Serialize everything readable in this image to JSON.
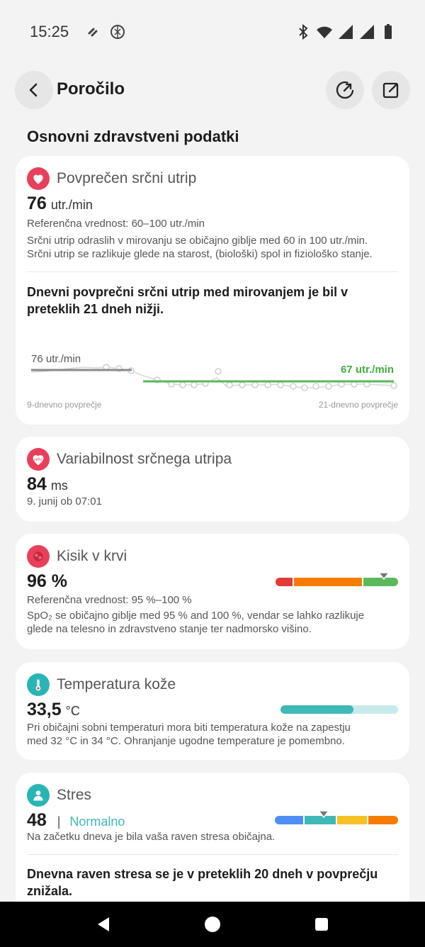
{
  "status": {
    "time": "15:25"
  },
  "header": {
    "title": "Poročilo"
  },
  "section": {
    "title": "Osnovni zdravstveni podatki"
  },
  "heart": {
    "title": "Povprečen srčni utrip",
    "value": "76",
    "unit": "utr./min",
    "reference": "Referenčna vrednost: 60–100 utr./min",
    "desc1": "Srčni utrip odraslih v mirovanju se običajno giblje med 60 in 100 utr./min.",
    "desc2": "Srčni utrip se razlikuje glede na starost, (biološki) spol in fiziološko stanje.",
    "insight": "Dnevni povprečni srčni utrip med mirovanjem je bil v preteklih 21 dneh nižji.",
    "chart_data": {
      "type": "line",
      "series": [
        {
          "name": "9-dnevno povprečje",
          "values": [
            76
          ]
        },
        {
          "name": "21-dnevno povprečje",
          "values": [
            67
          ]
        }
      ],
      "left_label": "76 utr./min",
      "right_label": "67 utr./min",
      "x_left": "9-dnevno povprečje",
      "x_right": "21-dnevno povprečje"
    }
  },
  "hrv": {
    "title": "Variabilnost srčnega utripa",
    "icon_text": "HRV",
    "value": "84",
    "unit": "ms",
    "date": "9. junij ob 07:01"
  },
  "spo2": {
    "title": "Kisik v krvi",
    "value": "96 %",
    "reference": "Referenčna vrednost: 95 %–100 %",
    "desc1": "SpO₂ se običajno giblje med 95 % and 100 %, vendar se lahko razlikuje",
    "desc2": "glede na telesno in zdravstveno stanje ter nadmorsko višino.",
    "colors": [
      "#e23a3a",
      "#f57c00",
      "#5cb85c"
    ]
  },
  "temp": {
    "title": "Temperatura kože",
    "value": "33,5",
    "unit": "°C",
    "desc1": "Pri običajni sobni temperaturi mora biti temperatura kože na zapestju",
    "desc2": "med 32 °C in 34 °C. Ohranjanje ugodne temperature je pomembno.",
    "fill": 0.62
  },
  "stress": {
    "title": "Stres",
    "value": "48",
    "level": "Normalno",
    "desc": "Na začetku dneva je bila vaša raven stresa običajna.",
    "insight": "Dnevna raven stresa se je v preteklih 20 dneh v povprečju znižala."
  }
}
